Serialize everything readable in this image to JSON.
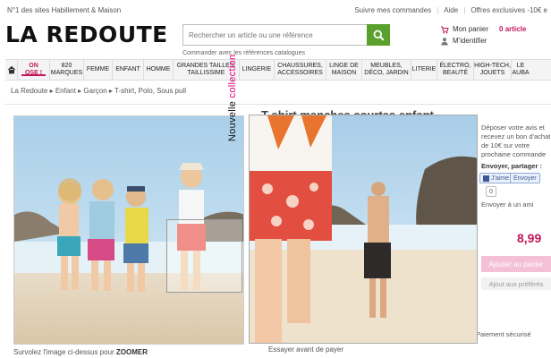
{
  "topbar": {
    "tagline": "N°1 des sites Habillement & Maison",
    "links": [
      "Suivre mes commandes",
      "Aide",
      "Offres exclusives -10€ e"
    ]
  },
  "logo": "LA REDOUTE",
  "search": {
    "placeholder": "Rechercher un article ou une référence",
    "sub": "Commander avec les références catalogues"
  },
  "cart": {
    "label": "Mon panier",
    "count": "0 article",
    "account": "M'identifier"
  },
  "nav": {
    "items": [
      "ON OSE !",
      "820\nMARQUES",
      "FEMME",
      "ENFANT",
      "HOMME",
      "GRANDES TAILLES,\nTAILLISSIME",
      "LINGERIE",
      "CHAUSSURES,\nACCESSOIRES",
      "LINGE DE\nMAISON",
      "MEUBLES,\nDÉCO, JARDIN",
      "LITERIE",
      "ÉLECTRO,\nBEAUTÉ",
      "HIGH-TECH,\nJOUETS",
      "LE\nAUBA"
    ]
  },
  "breadcrumb": "La Redoute ▸ Enfant ▸ Garçon ▸ T-shirt, Polo, Sous pull",
  "product": {
    "title": "T-shirt manches courtes enfant",
    "collection_a": "Nouvelle ",
    "collection_b": "collection",
    "zoom_hint_a": "Survolez l'image ci-dessus pour ",
    "zoom_hint_b": "ZOOMER",
    "essayer": "Essayer avant de payer"
  },
  "side": {
    "promo": "Déposer votre avis et recevez un bon d'achat de 10€ sur votre prochaine commande",
    "share_label": "Envoyer, partager :",
    "jaime": "J'aime",
    "envoyer": "Envoyer",
    "like_count": "0",
    "envoyer_ami": "Envoyer à un ami",
    "price": "8,99",
    "add_to_cart": "Ajouter au panier",
    "plus_pref": "Ajout aux préférés",
    "paiement": "Paiement sécurisé"
  },
  "colors": {
    "brand_pink": "#c2185b",
    "search_green": "#5aa02c"
  }
}
